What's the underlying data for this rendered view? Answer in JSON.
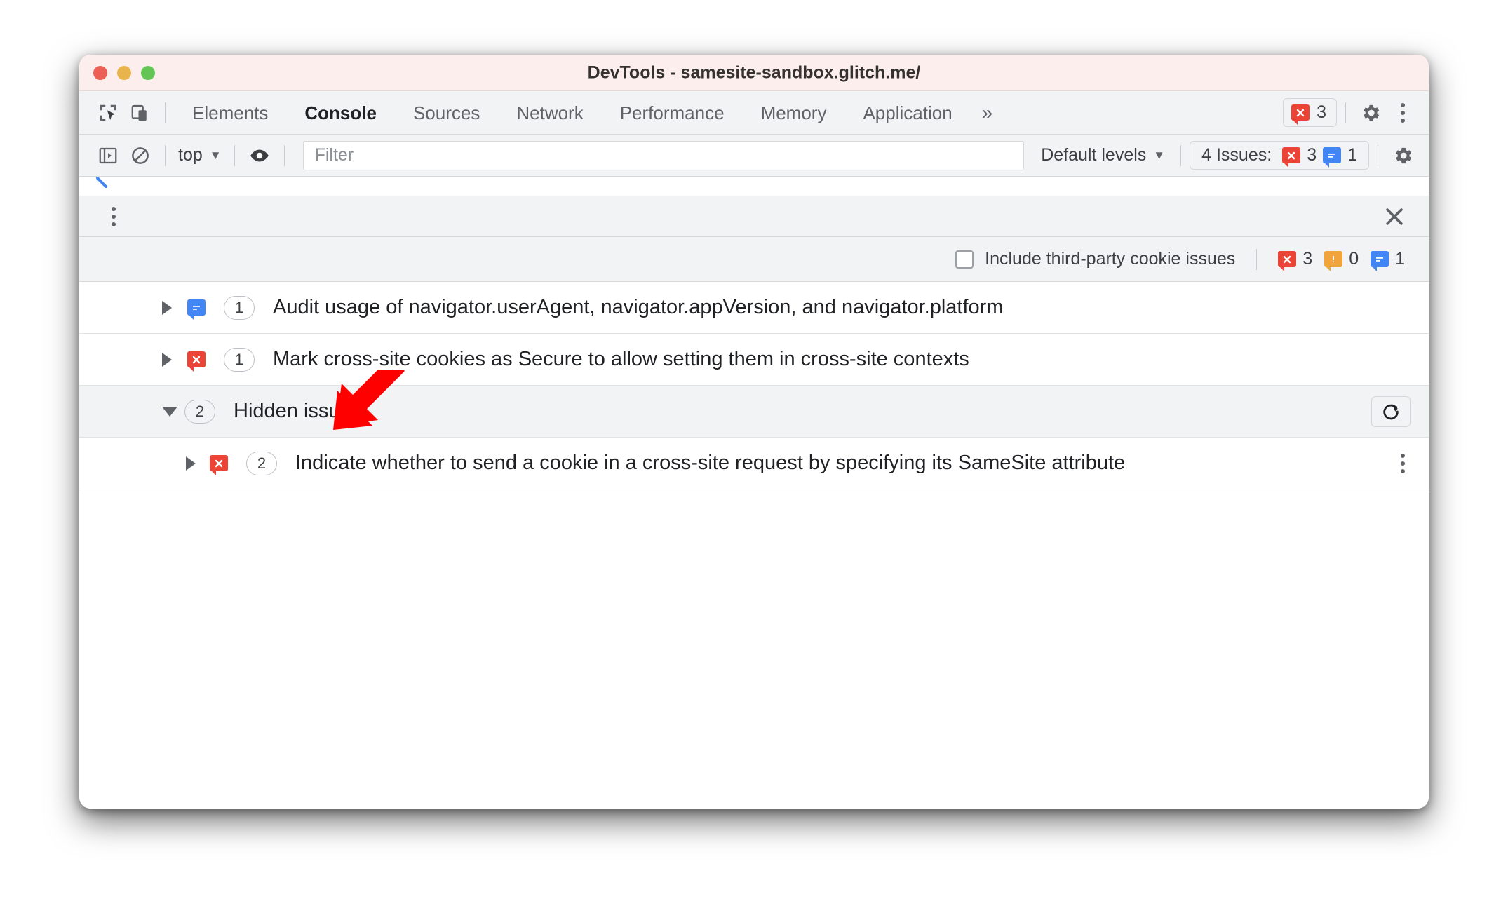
{
  "window": {
    "title": "DevTools - samesite-sandbox.glitch.me/",
    "traffic_lights": [
      "close",
      "minimize",
      "zoom"
    ],
    "colors": {
      "titlebar_bg": "#fbeeec",
      "toolbar_bg": "#f1f3f4",
      "error_red": "#eb4335",
      "info_blue": "#4285f4",
      "warning_orange": "#f1a33c",
      "annotation_red": "#ff0000"
    }
  },
  "tabbar": {
    "inspect_icon": "inspect-element-icon",
    "device_icon": "device-toolbar-icon",
    "tabs": [
      {
        "label": "Elements",
        "active": false
      },
      {
        "label": "Console",
        "active": true
      },
      {
        "label": "Sources",
        "active": false
      },
      {
        "label": "Network",
        "active": false
      },
      {
        "label": "Performance",
        "active": false
      },
      {
        "label": "Memory",
        "active": false
      },
      {
        "label": "Application",
        "active": false
      }
    ],
    "more_tabs": "»",
    "error_count": "3",
    "settings_icon": "gear-icon",
    "more_icon": "kebab-menu-icon"
  },
  "console_toolbar": {
    "sidebar_toggle": "console-sidebar-icon",
    "clear_console": "clear-console-icon",
    "context_label": "top",
    "context_caret": "▼",
    "eye_icon": "live-expression-icon",
    "filter_placeholder": "Filter",
    "filter_value": "",
    "levels_label": "Default levels",
    "levels_caret": "▼",
    "issues_label": "4 Issues:",
    "issues_error_count": "3",
    "issues_info_count": "1",
    "settings_icon": "gear-icon"
  },
  "drawer": {
    "menu_icon": "kebab-menu-icon",
    "close_icon": "close-icon"
  },
  "issues_toolbar": {
    "checkbox_label": "Include third-party cookie issues",
    "checkbox_checked": false,
    "error_count": "3",
    "warning_count": "0",
    "info_count": "1"
  },
  "issues": [
    {
      "kind": "info",
      "count": "1",
      "expanded": false,
      "title": "Audit usage of navigator.userAgent, navigator.appVersion, and navigator.platform"
    },
    {
      "kind": "error",
      "count": "1",
      "expanded": false,
      "title": "Mark cross-site cookies as Secure to allow setting them in cross-site contexts"
    }
  ],
  "hidden_group": {
    "count": "2",
    "label": "Hidden issues",
    "expanded": true,
    "refresh_icon": "refresh-icon",
    "children": [
      {
        "kind": "error",
        "count": "2",
        "expanded": false,
        "title": "Indicate whether to send a cookie in a cross-site request by specifying its SameSite attribute",
        "menu_icon": "kebab-menu-icon"
      }
    ]
  },
  "annotation": {
    "arrow": "red-arrow-pointing-to-hidden-issues"
  }
}
